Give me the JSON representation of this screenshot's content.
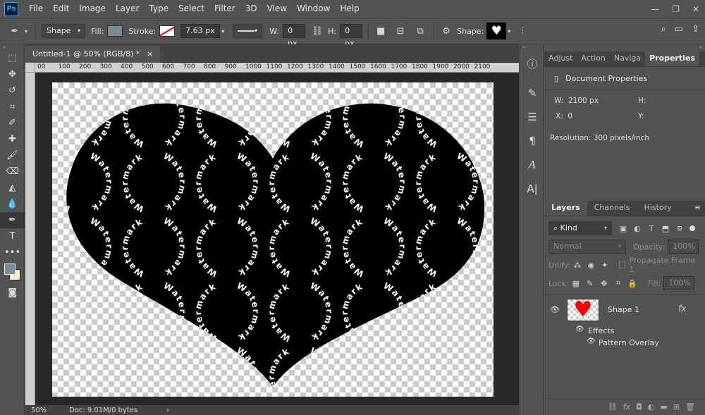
{
  "menubar": {
    "logo": "Ps",
    "items": [
      "File",
      "Edit",
      "Image",
      "Layer",
      "Type",
      "Select",
      "Filter",
      "3D",
      "View",
      "Window",
      "Help"
    ]
  },
  "options": {
    "tool_mode": "Shape",
    "fill_label": "Fill:",
    "fill_color": "#7d8a99",
    "stroke_label": "Stroke:",
    "stroke_width": "7.63 px",
    "w_label": "W:",
    "w_value": "0 px",
    "h_label": "H:",
    "h_value": "0 px",
    "shape_label": "Shape:"
  },
  "document": {
    "tab_title": "Untitled-1 @ 50% (RGB/8) *",
    "ruler_labels": [
      "00",
      "100",
      "200",
      "300",
      "400",
      "500",
      "600",
      "700",
      "800",
      "900",
      "1000",
      "1100",
      "1200",
      "1300",
      "1400",
      "1500",
      "1600",
      "1700",
      "1800",
      "1900",
      "2000",
      "2100"
    ],
    "zoom": "50%",
    "doc_size": "Doc: 9.01M/0 bytes",
    "watermark_text": "Watermark"
  },
  "panels": {
    "top_tabs": [
      "Adjust",
      "Action",
      "Naviga",
      "Properties"
    ],
    "active_top_tab": "Properties",
    "properties": {
      "section": "Document Properties",
      "w_label": "W:",
      "w_value": "2100 px",
      "h_label": "H:",
      "x_label": "X:",
      "x_value": "0",
      "y_label": "Y:",
      "resolution": "Resolution: 300 pixels/inch"
    },
    "layer_tabs": [
      "Layers",
      "Channels",
      "History"
    ],
    "active_layer_tab": "Layers",
    "layers": {
      "filter_kind": "Kind",
      "blend_mode": "Normal",
      "opacity_label": "Opacity:",
      "opacity_value": "100%",
      "unify_label": "Unify:",
      "propagate_label": "Propagate Frame 1",
      "lock_label": "Lock:",
      "fill_label": "Fill:",
      "fill_value": "100%",
      "layer_name": "Shape 1",
      "fx_label": "fx",
      "effects_label": "Effects",
      "effect_name": "Pattern Overlay"
    }
  }
}
